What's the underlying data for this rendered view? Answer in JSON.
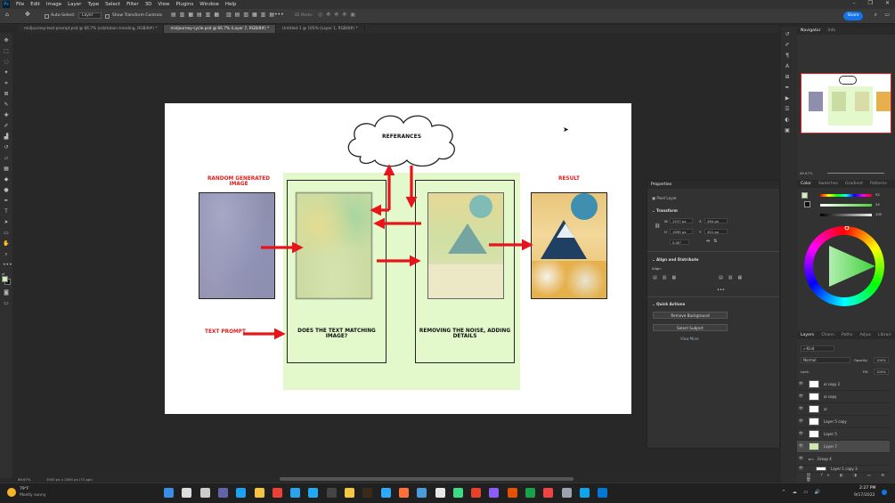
{
  "app": {
    "logo": "Ps",
    "window_controls": [
      "–",
      "❐",
      "✕"
    ]
  },
  "menu": [
    "File",
    "Edit",
    "Image",
    "Layer",
    "Type",
    "Select",
    "Filter",
    "3D",
    "View",
    "Plugins",
    "Window",
    "Help"
  ],
  "options_bar": {
    "auto_select_label": "Auto-Select:",
    "auto_select_value": "Layer",
    "transform_controls_label": "Show Transform Controls",
    "mode_3d": "3D Mode:",
    "share_label": "Share"
  },
  "tabs": [
    {
      "label": "midjourney-text-prompt.psd @ 66.7% (orbitation trending, RGB/8#) *"
    },
    {
      "label": "midjourney-cycle.psd @ 66.7% (Layer 7, RGB/8#) *"
    },
    {
      "label": "Untitled-1 @ 195% (Layer 1, RGB/8#) *"
    }
  ],
  "document": {
    "cloud_label": "REFERANCES",
    "random_label": "RANDOM GENERATED IMAGE",
    "text_prompt_label": "TEXT PROMPT",
    "match_label": "DOES THE TEXT MATCHING IMAGE?",
    "noise_label": "REMOVING THE NOISE, ADDING DETAILS",
    "result_label": "RESULT"
  },
  "status": {
    "zoom": "66.67%",
    "doc_size": "3000 px x 2000 px (72 ppi)"
  },
  "navigator": {
    "tabs": [
      "Navigator",
      "Info"
    ],
    "zoom": "66.67%"
  },
  "color_panel": {
    "tabs": [
      "Color",
      "Swatches",
      "Gradient",
      "Patterns"
    ],
    "values": [
      "92",
      "34",
      "100"
    ]
  },
  "properties": {
    "title": "Properties",
    "layer_type": "Pixel Layer",
    "transform_title": "Transform",
    "w_label": "W",
    "w_value": "1517 px",
    "h_label": "H",
    "h_value": "1995 px",
    "x_label": "X",
    "x_value": "264 px",
    "y_label": "Y",
    "y_value": "451 px",
    "angle_value": "0.00°",
    "align_title": "Align and Distribute",
    "align_label": "Align:",
    "quick_title": "Quick Actions",
    "remove_bg": "Remove Background",
    "select_subject": "Select Subject",
    "view_more": "View More"
  },
  "layers_panel": {
    "tabs": [
      "Layers",
      "Chann",
      "Paths",
      "Adjus",
      "Librari"
    ],
    "kind": "Kind",
    "blend": "Normal",
    "opacity_label": "Opacity:",
    "opacity_value": "100%",
    "lock_label": "Lock:",
    "fill_label": "Fill:",
    "fill_value": "100%",
    "layers": [
      {
        "name": "ai copy 2",
        "selected": false
      },
      {
        "name": "ai copy",
        "selected": false
      },
      {
        "name": "ai",
        "selected": false
      },
      {
        "name": "Layer 5 copy",
        "selected": false
      },
      {
        "name": "Layer 5",
        "selected": false
      },
      {
        "name": "Layer 7",
        "selected": true
      },
      {
        "name": "Group 4",
        "selected": false
      },
      {
        "name": "Layer 1 copy 3",
        "selected": false
      }
    ]
  },
  "taskbar": {
    "weather_temp": "79°F",
    "weather_desc": "Mostly sunny",
    "time": "2:27 PM",
    "date": "9/17/2022",
    "apps": [
      {
        "icon": "windows-icon",
        "color": "#3a8ee6"
      },
      {
        "icon": "search-icon",
        "color": "#ddd"
      },
      {
        "icon": "task-view-icon",
        "color": "#ccc"
      },
      {
        "icon": "chat-icon",
        "color": "#6264a7"
      },
      {
        "icon": "edge-icon",
        "color": "#1da1f2"
      },
      {
        "icon": "folder-icon",
        "color": "#f4c542"
      },
      {
        "icon": "chrome-icon",
        "color": "#e94235"
      },
      {
        "icon": "store-icon",
        "color": "#2aa3e8"
      },
      {
        "icon": "vscode-icon",
        "color": "#23a9f2"
      },
      {
        "icon": "terminal-icon",
        "color": "#444"
      },
      {
        "icon": "notes-icon",
        "color": "#f2c744"
      },
      {
        "icon": "bridge-icon",
        "color": "#3a2a1a"
      },
      {
        "icon": "ps-icon",
        "color": "#31a8ff"
      },
      {
        "icon": "firefox-icon",
        "color": "#ff7139"
      },
      {
        "icon": "app-icon",
        "color": "#4b9bd6"
      },
      {
        "icon": "app-icon",
        "color": "#e8e8e8"
      },
      {
        "icon": "app-icon",
        "color": "#3ddc84"
      },
      {
        "icon": "app-icon",
        "color": "#e8412b"
      },
      {
        "icon": "app-icon",
        "color": "#8b5cf6"
      },
      {
        "icon": "app-icon",
        "color": "#e65100"
      },
      {
        "icon": "app-icon",
        "color": "#16a34a"
      },
      {
        "icon": "app-icon",
        "color": "#ef4444"
      },
      {
        "icon": "settings-icon",
        "color": "#9ca3af"
      },
      {
        "icon": "app-icon",
        "color": "#0ea5e9"
      },
      {
        "icon": "app-icon",
        "color": "#0078d4"
      }
    ]
  }
}
